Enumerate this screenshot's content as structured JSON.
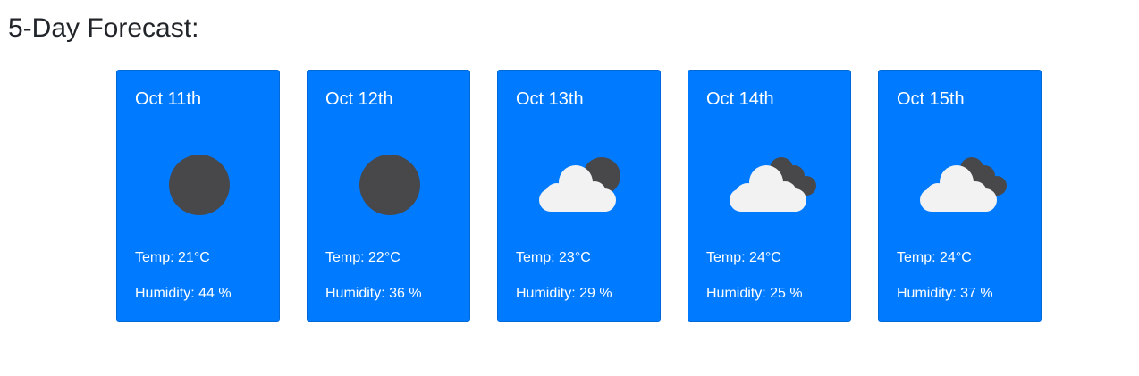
{
  "forecast": {
    "title": "5-Day Forecast:",
    "days": [
      {
        "date": "Oct 11th",
        "icon": "clear-night-icon",
        "temp": "Temp: 21°C",
        "humidity": "Humidity: 44 %"
      },
      {
        "date": "Oct 12th",
        "icon": "clear-night-icon",
        "temp": "Temp: 22°C",
        "humidity": "Humidity: 36 %"
      },
      {
        "date": "Oct 13th",
        "icon": "partly-cloudy-night-icon",
        "temp": "Temp: 23°C",
        "humidity": "Humidity: 29 %"
      },
      {
        "date": "Oct 14th",
        "icon": "broken-clouds-night-icon",
        "temp": "Temp: 24°C",
        "humidity": "Humidity: 25 %"
      },
      {
        "date": "Oct 15th",
        "icon": "broken-clouds-night-icon",
        "temp": "Temp: 24°C",
        "humidity": "Humidity: 37 %"
      }
    ]
  },
  "colors": {
    "card_background": "#007bff",
    "moon": "#48484a",
    "cloud": "#f2f2f2",
    "text": "#ffffff"
  }
}
